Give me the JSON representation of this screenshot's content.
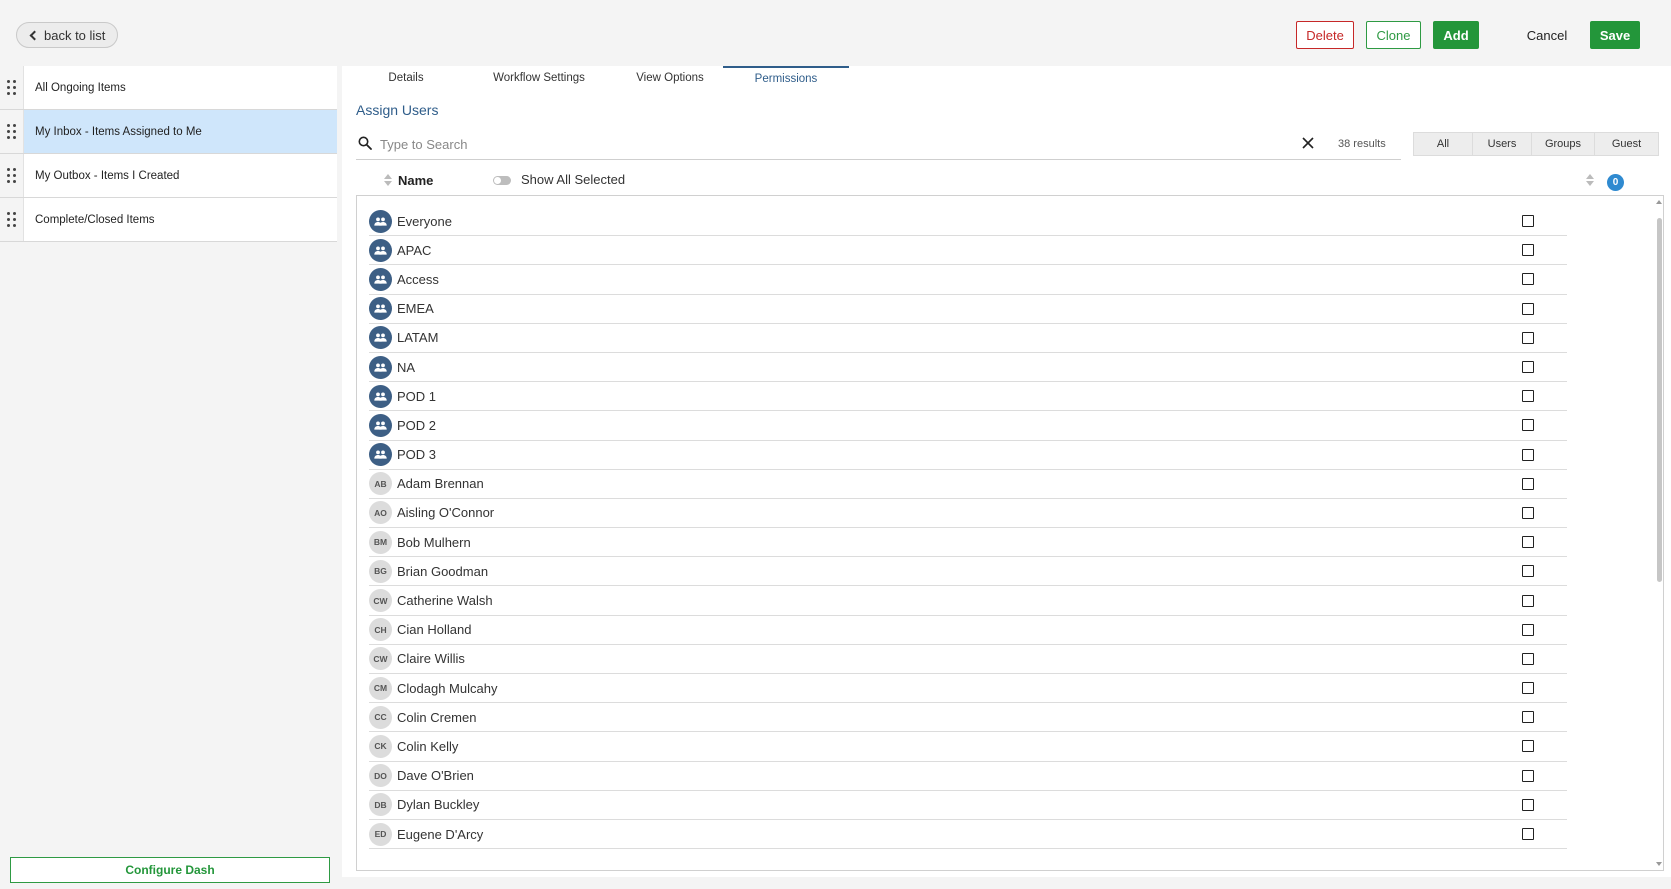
{
  "top": {
    "back_label": "back to list",
    "delete_label": "Delete",
    "clone_label": "Clone",
    "add_label": "Add",
    "cancel_label": "Cancel",
    "save_label": "Save"
  },
  "sidebar": {
    "items": [
      {
        "label": "All Ongoing Items"
      },
      {
        "label": "My Inbox - Items Assigned to Me"
      },
      {
        "label": "My Outbox - Items I Created"
      },
      {
        "label": "Complete/Closed Items"
      }
    ],
    "configure_label": "Configure Dash"
  },
  "tabs": {
    "details": "Details",
    "workflow": "Workflow Settings",
    "view": "View Options",
    "permissions": "Permissions"
  },
  "assign": {
    "title": "Assign Users",
    "search_placeholder": "Type to Search",
    "results_count": "38 results",
    "filters": [
      "All",
      "Users",
      "Groups",
      "Guest"
    ],
    "name_header": "Name",
    "show_all_selected": "Show All Selected",
    "selected_count": "0"
  },
  "rows": [
    {
      "type": "group",
      "name": "Everyone"
    },
    {
      "type": "group",
      "name": "APAC"
    },
    {
      "type": "group",
      "name": "Access"
    },
    {
      "type": "group",
      "name": "EMEA"
    },
    {
      "type": "group",
      "name": "LATAM"
    },
    {
      "type": "group",
      "name": "NA"
    },
    {
      "type": "group",
      "name": "POD 1"
    },
    {
      "type": "group",
      "name": "POD 2"
    },
    {
      "type": "group",
      "name": "POD 3"
    },
    {
      "type": "user",
      "initials": "AB",
      "name": "Adam Brennan"
    },
    {
      "type": "user",
      "initials": "AO",
      "name": "Aisling O'Connor"
    },
    {
      "type": "user",
      "initials": "BM",
      "name": "Bob Mulhern"
    },
    {
      "type": "user",
      "initials": "BG",
      "name": "Brian Goodman"
    },
    {
      "type": "user",
      "initials": "CW",
      "name": "Catherine Walsh"
    },
    {
      "type": "user",
      "initials": "CH",
      "name": "Cian Holland"
    },
    {
      "type": "user",
      "initials": "CW",
      "name": "Claire Willis"
    },
    {
      "type": "user",
      "initials": "CM",
      "name": "Clodagh Mulcahy"
    },
    {
      "type": "user",
      "initials": "CC",
      "name": "Colin Cremen"
    },
    {
      "type": "user",
      "initials": "CK",
      "name": "Colin Kelly"
    },
    {
      "type": "user",
      "initials": "DO",
      "name": "Dave O'Brien"
    },
    {
      "type": "user",
      "initials": "DB",
      "name": "Dylan Buckley"
    },
    {
      "type": "user",
      "initials": "ED",
      "name": "Eugene D'Arcy"
    }
  ],
  "colors": {
    "accent": "#2f5d8a",
    "green": "#23963a",
    "danger": "#c62828",
    "active_row": "#cfe6fb",
    "group_avatar": "#3d5f85",
    "badge": "#2f8ad0"
  }
}
